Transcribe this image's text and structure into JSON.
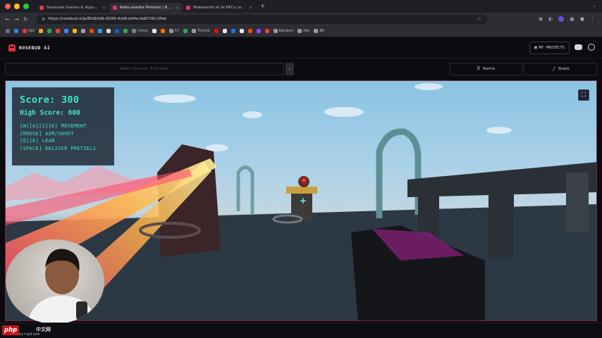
{
  "browser": {
    "tabs": [
      {
        "title": "Generate Games & Apps with...",
        "active": false
      },
      {
        "title": "Robo-starbie Pretzels | Ro...",
        "active": true
      },
      {
        "title": "Makeworld w/ AI NPCs (and...",
        "active": false
      }
    ],
    "url": "https://rosebud.ai/p/85db3db-8166-4cb8-bd4e-bb8726c1ffeb",
    "bookmarks": [
      "Opt",
      "Comp",
      "57",
      "Thumb",
      "Random",
      "Ads",
      "Bit"
    ]
  },
  "app": {
    "brand": "ROSEBUD AI",
    "my_projects_label": "MY PROJECTS",
    "project_title_placeholder": "Robo-starbie Pretzels",
    "remix_label": "Remix",
    "share_label": "Share",
    "collapse_icon": "chevron-right-icon",
    "fullscreen_icon": "expand-icon",
    "description_label": "Description"
  },
  "hud": {
    "score_text": "Score: 300",
    "high_score_text": "High Score: 600",
    "controls": [
      "[W][A][S][D] MOVEMENT",
      "[MOUSE] AIM/SHOOT",
      "[Q][E] LEAN",
      "[SPACE] DELIVER PRETZELS"
    ],
    "text_color": "#3fe6c8"
  },
  "watermark": {
    "logo": "php",
    "suffix": "中文网"
  },
  "colors": {
    "brand": "#e53045",
    "laser": "#ffb44a",
    "background": "#0b0b10"
  }
}
